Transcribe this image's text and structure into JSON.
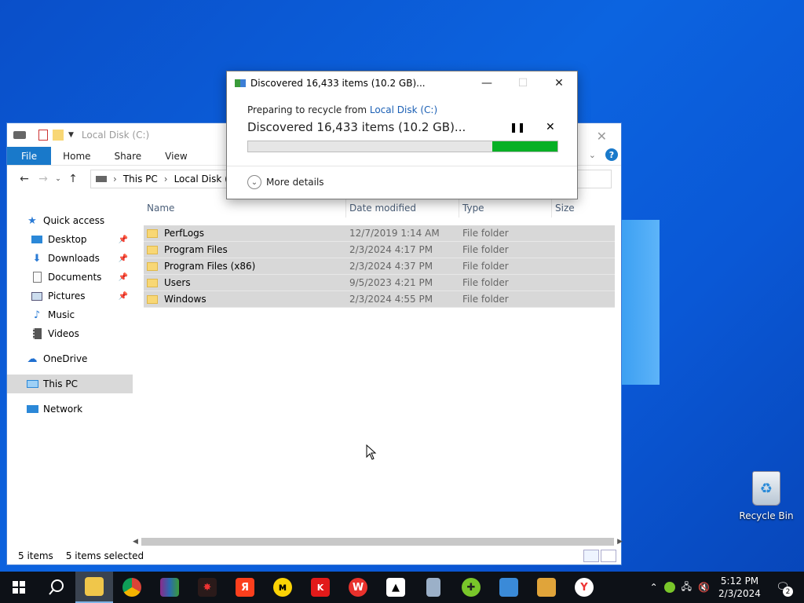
{
  "dialog": {
    "title": "Discovered 16,433 items (10.2 GB)...",
    "preparing_prefix": "Preparing to recycle from",
    "source_link": "Local Disk (C:)",
    "status": "Discovered 16,433 items (10.2 GB)...",
    "pause_icon": "pause-icon",
    "cancel_icon": "close-icon",
    "progress": 0.21,
    "more_details": "More details"
  },
  "explorer": {
    "title": "Local Disk (C:)",
    "tabs": [
      "File",
      "Home",
      "Share",
      "View"
    ],
    "breadcrumb": [
      "This PC",
      "Local Disk (C:)"
    ],
    "sidebar": [
      {
        "label": "Quick access",
        "icon": "star-icon",
        "pinned": false
      },
      {
        "label": "Desktop",
        "icon": "desktop-icon",
        "pinned": true
      },
      {
        "label": "Downloads",
        "icon": "download-icon",
        "pinned": true
      },
      {
        "label": "Documents",
        "icon": "document-icon",
        "pinned": true
      },
      {
        "label": "Pictures",
        "icon": "picture-icon",
        "pinned": true
      },
      {
        "label": "Music",
        "icon": "music-icon",
        "pinned": false
      },
      {
        "label": "Videos",
        "icon": "video-icon",
        "pinned": false
      },
      {
        "label": "OneDrive",
        "icon": "cloud-icon",
        "pinned": false
      },
      {
        "label": "This PC",
        "icon": "computer-icon",
        "pinned": false
      },
      {
        "label": "Network",
        "icon": "network-icon",
        "pinned": false
      }
    ],
    "columns": [
      "Name",
      "Date modified",
      "Type",
      "Size"
    ],
    "rows": [
      {
        "name": "PerfLogs",
        "date": "12/7/2019 1:14 AM",
        "type": "File folder",
        "size": ""
      },
      {
        "name": "Program Files",
        "date": "2/3/2024 4:17 PM",
        "type": "File folder",
        "size": ""
      },
      {
        "name": "Program Files (x86)",
        "date": "2/3/2024 4:37 PM",
        "type": "File folder",
        "size": ""
      },
      {
        "name": "Users",
        "date": "9/5/2023 4:21 PM",
        "type": "File folder",
        "size": ""
      },
      {
        "name": "Windows",
        "date": "2/3/2024 4:55 PM",
        "type": "File folder",
        "size": ""
      }
    ],
    "status_items": "5 items",
    "status_selected": "5 items selected"
  },
  "desktop": {
    "recycle_bin": "Recycle Bin"
  },
  "taskbar": {
    "time": "5:12 PM",
    "date": "2/3/2024",
    "notification_count": "2"
  }
}
